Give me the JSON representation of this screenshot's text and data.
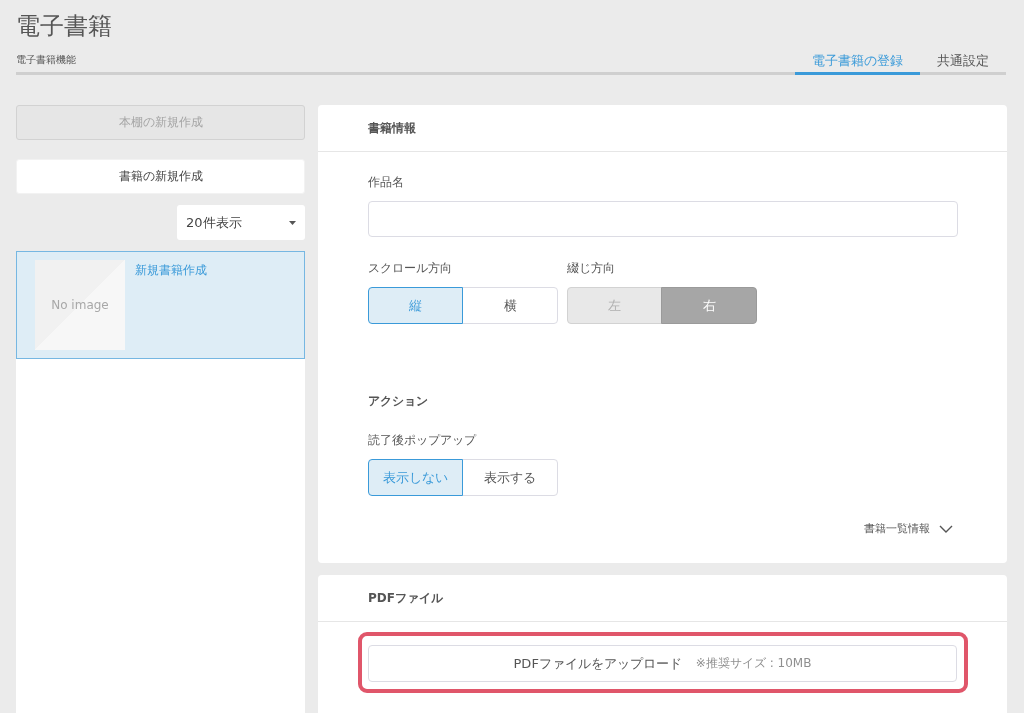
{
  "page": {
    "title": "電子書籍",
    "subtitle": "電子書籍機能"
  },
  "tabs": [
    {
      "label": "電子書籍の登録",
      "selected": true
    },
    {
      "label": "共通設定",
      "selected": false
    }
  ],
  "sidebar": {
    "buttons": [
      {
        "label": "本棚の新規作成",
        "disabled": true
      },
      {
        "label": "書籍の新規作成",
        "disabled": false
      }
    ],
    "page_size": {
      "value": "20件表示"
    },
    "books": [
      {
        "title": "新規書籍作成",
        "thumbnail": "No image",
        "selected": true
      }
    ]
  },
  "book_info": {
    "title": "書籍情報",
    "rows": [
      {
        "fields": [
          {
            "kind": "text",
            "label": "作品名"
          }
        ]
      },
      {
        "fields": [
          {
            "kind": "segmented",
            "label": "スクロール方向",
            "options": [
              {
                "label": "縦",
                "selected": true,
                "disabled": false
              },
              {
                "label": "横",
                "selected": false,
                "disabled": false
              }
            ]
          },
          {
            "kind": "segmented",
            "label": "綴じ方向",
            "options": [
              {
                "label": "左",
                "selected": false,
                "disabled": true
              },
              {
                "label": "右",
                "selected": true,
                "disabled": true
              }
            ]
          }
        ]
      }
    ],
    "action": {
      "title": "アクション",
      "rows": [
        {
          "fields": [
            {
              "kind": "segmented",
              "label": "読了後ポップアップ",
              "options": [
                {
                  "label": "表示しない",
                  "selected": true,
                  "disabled": false
                },
                {
                  "label": "表示する",
                  "selected": false,
                  "disabled": false
                }
              ]
            }
          ]
        }
      ]
    },
    "toggle": {
      "label": "書籍一覧情報",
      "expanded": false
    }
  },
  "pdf": {
    "title": "PDFファイル",
    "highlighted": true,
    "upload": {
      "label": "PDFファイルをアップロード",
      "note": "※推奨サイズ : 10MB"
    }
  }
}
